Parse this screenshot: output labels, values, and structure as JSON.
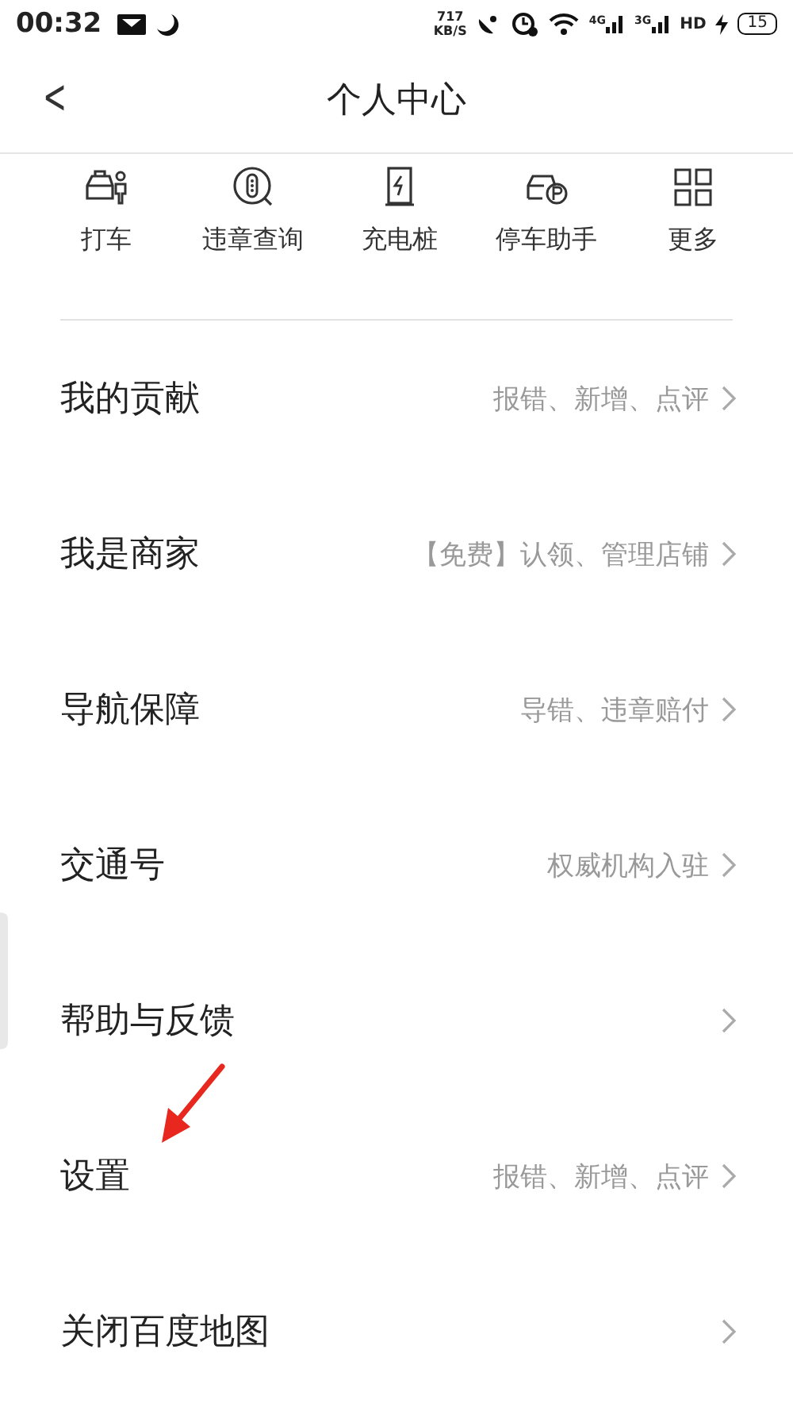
{
  "status_bar": {
    "time": "00:32",
    "speed_value": "717",
    "speed_unit": "KB/S",
    "network_1": "4G",
    "network_2": "3G",
    "hd": "HD",
    "battery": "15"
  },
  "header": {
    "back": "<",
    "title": "个人中心"
  },
  "shortcuts": [
    {
      "kind": "taxi",
      "label": "打车"
    },
    {
      "kind": "violation",
      "label": "违章查询"
    },
    {
      "kind": "charger",
      "label": "充电桩"
    },
    {
      "kind": "parking",
      "label": "停车助手"
    },
    {
      "kind": "more",
      "label": "更多"
    }
  ],
  "menu": [
    {
      "label": "我的贡献",
      "hint": "报错、新增、点评"
    },
    {
      "label": "我是商家",
      "hint": "【免费】认领、管理店铺"
    },
    {
      "label": "导航保障",
      "hint": "导错、违章赔付"
    },
    {
      "label": "交通号",
      "hint": "权威机构入驻"
    },
    {
      "label": "帮助与反馈"
    },
    {
      "label": "设置",
      "hint": "报错、新增、点评",
      "annotated": true
    },
    {
      "label": "关闭百度地图"
    }
  ]
}
